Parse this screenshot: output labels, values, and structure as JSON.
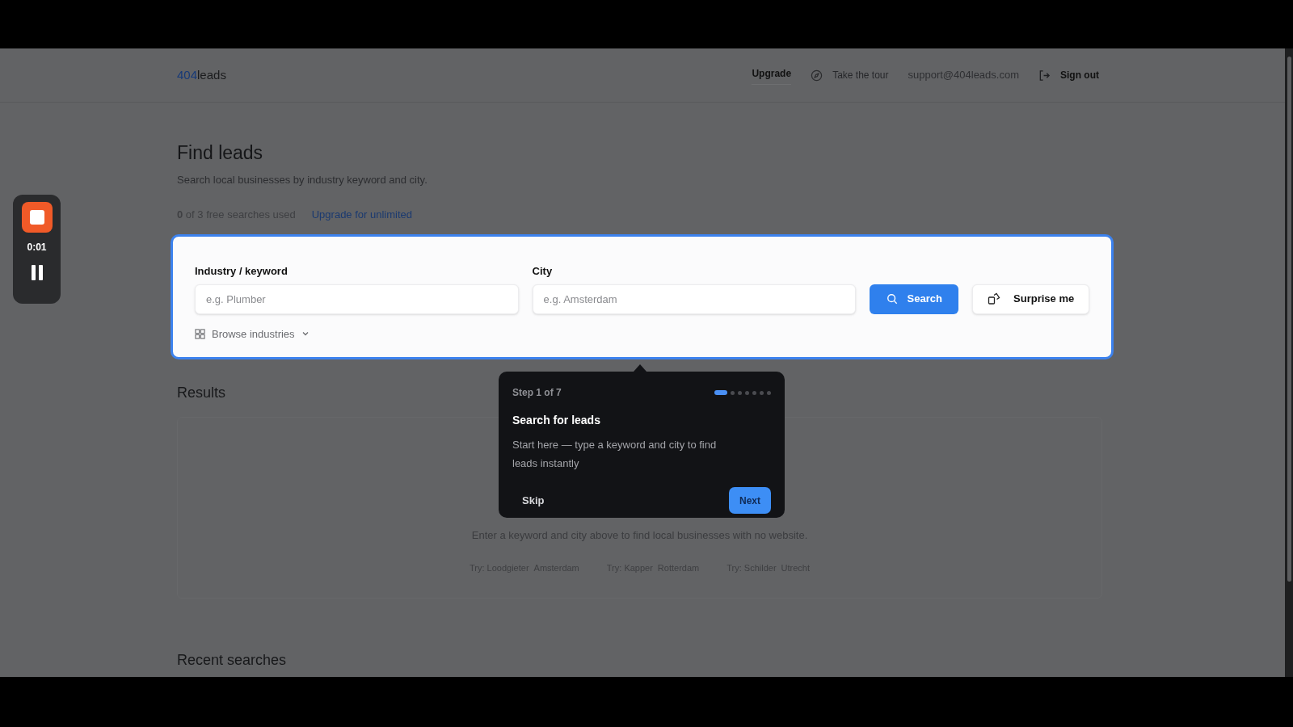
{
  "header": {
    "logo_prefix": "404",
    "logo_suffix": "leads",
    "upgrade": "Upgrade",
    "tour": "Take the tour",
    "email": "support@404leads.com",
    "sign_out": "Sign out"
  },
  "recorder": {
    "time": "0:01"
  },
  "page": {
    "title": "Find leads",
    "subtitle": "Search local businesses by industry keyword and city.",
    "usage": "**0** of 3 free searches used",
    "upgrade_link": "Upgrade for unlimited"
  },
  "search": {
    "keyword_label": "Industry / keyword",
    "keyword_placeholder": "e.g. Plumber",
    "city_label": "City",
    "city_placeholder": "e.g. Amsterdam",
    "search_button": "Search",
    "surprise_button": "Surprise me",
    "browse": "Browse industries"
  },
  "results": {
    "title": "Results",
    "empty_text": "Enter a keyword and city above to find local businesses with no website.",
    "suggestions": [
      {
        "prefix": "Try:",
        "keyword": "Loodgieter",
        "city": "Amsterdam"
      },
      {
        "prefix": "Try:",
        "keyword": "Kapper",
        "city": "Rotterdam"
      },
      {
        "prefix": "Try:",
        "keyword": "Schilder",
        "city": "Utrecht"
      }
    ]
  },
  "recent": {
    "title": "Recent searches"
  },
  "tour": {
    "step_label": "Step 1 of 7",
    "title": "Search for leads",
    "body": "Start here — type a keyword and city to find leads instantly",
    "steps": [
      {
        "selected": true
      },
      {
        "selected": false
      },
      {
        "selected": false
      },
      {
        "selected": false
      },
      {
        "selected": false
      },
      {
        "selected": false
      },
      {
        "selected": false
      }
    ],
    "skip": "Skip",
    "next": "Next"
  }
}
